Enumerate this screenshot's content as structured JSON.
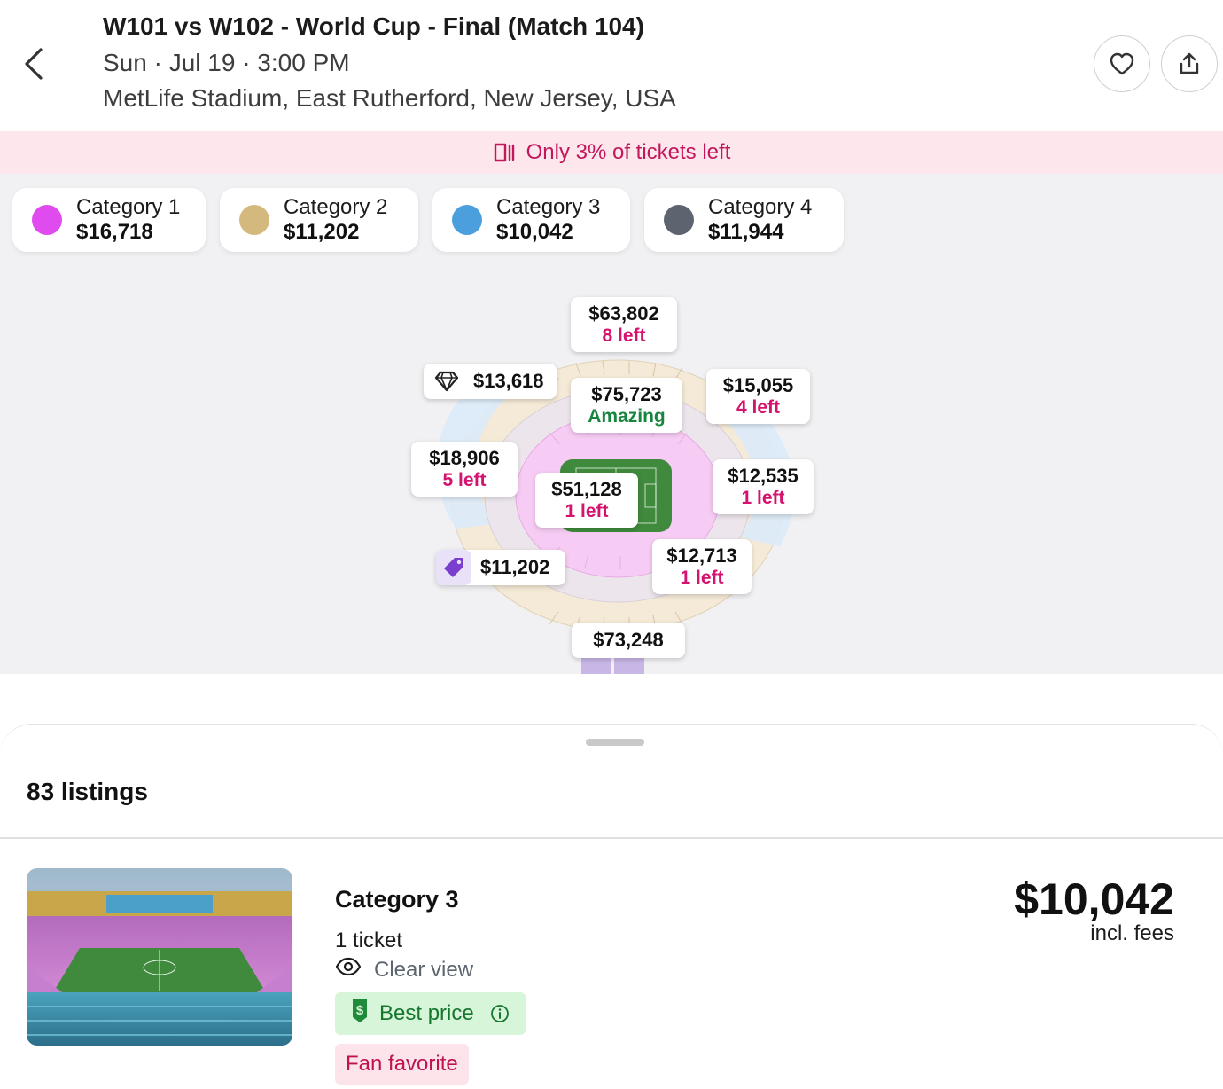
{
  "header": {
    "title": "W101 vs W102 - World Cup - Final (Match 104)",
    "datetime": "Sun · Jul 19 · 3:00 PM",
    "venue": "MetLife Stadium, East Rutherford, New Jersey, USA"
  },
  "banner": {
    "text": "Only 3% of tickets left",
    "color": "#c2185b"
  },
  "categories": [
    {
      "name": "Category 1",
      "price": "$16,718",
      "color": "#e04bf0"
    },
    {
      "name": "Category 2",
      "price": "$11,202",
      "color": "#d4b97e"
    },
    {
      "name": "Category 3",
      "price": "$10,042",
      "color": "#4a9fdc"
    },
    {
      "name": "Category 4",
      "price": "$11,944",
      "color": "#5d6470"
    }
  ],
  "map_prices": [
    {
      "price": "$63,802",
      "note": "8 left"
    },
    {
      "price": "$13,618",
      "icon": "diamond-icon"
    },
    {
      "price": "$75,723",
      "note": "Amazing"
    },
    {
      "price": "$15,055",
      "note": "4 left"
    },
    {
      "price": "$18,906",
      "note": "5 left"
    },
    {
      "price": "$51,128",
      "note": "1 left"
    },
    {
      "price": "$12,535",
      "note": "1 left"
    },
    {
      "price": "$11,202",
      "icon": "price-tag-icon"
    },
    {
      "price": "$12,713",
      "note": "1 left"
    },
    {
      "price": "$73,248"
    }
  ],
  "listings": {
    "count_label": "83 listings",
    "items": [
      {
        "category": "Category 3",
        "quantity": "1 ticket",
        "view": "Clear view",
        "badge_best": "Best price",
        "badge_fan": "Fan favorite",
        "price": "$10,042",
        "fees": "incl. fees"
      }
    ]
  }
}
